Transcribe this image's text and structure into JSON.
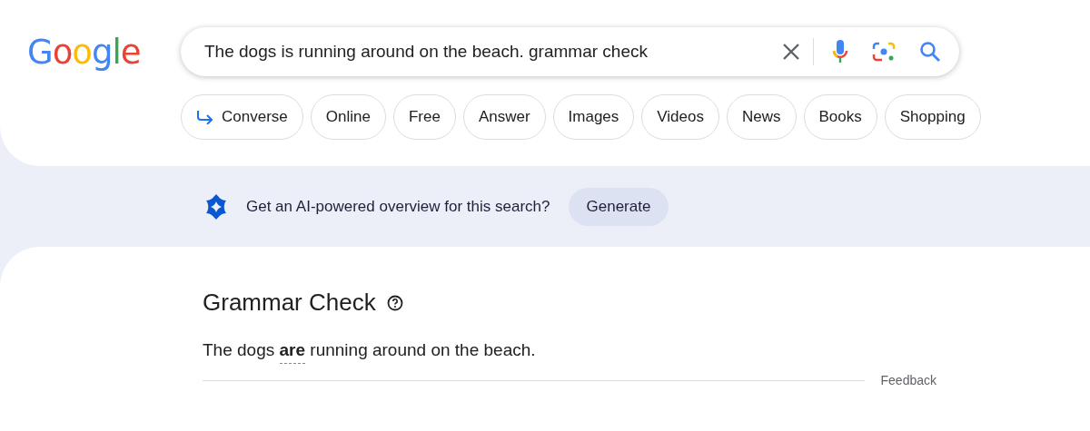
{
  "logo": "Google",
  "search": {
    "value": "The dogs is running around on the beach. grammar check"
  },
  "chips": [
    {
      "label": "Converse",
      "kind": "arrow"
    },
    {
      "label": "Online",
      "kind": "plain"
    },
    {
      "label": "Free",
      "kind": "plain"
    },
    {
      "label": "Answer",
      "kind": "plain"
    },
    {
      "label": "Images",
      "kind": "plain"
    },
    {
      "label": "Videos",
      "kind": "plain"
    },
    {
      "label": "News",
      "kind": "plain"
    },
    {
      "label": "Books",
      "kind": "plain"
    },
    {
      "label": "Shopping",
      "kind": "plain"
    }
  ],
  "ai_banner": {
    "text": "Get an AI-powered overview for this search?",
    "button": "Generate"
  },
  "grammar_check": {
    "title": "Grammar Check",
    "sentence": "The dogs **are** running around on the beach.",
    "feedback": "Feedback"
  }
}
